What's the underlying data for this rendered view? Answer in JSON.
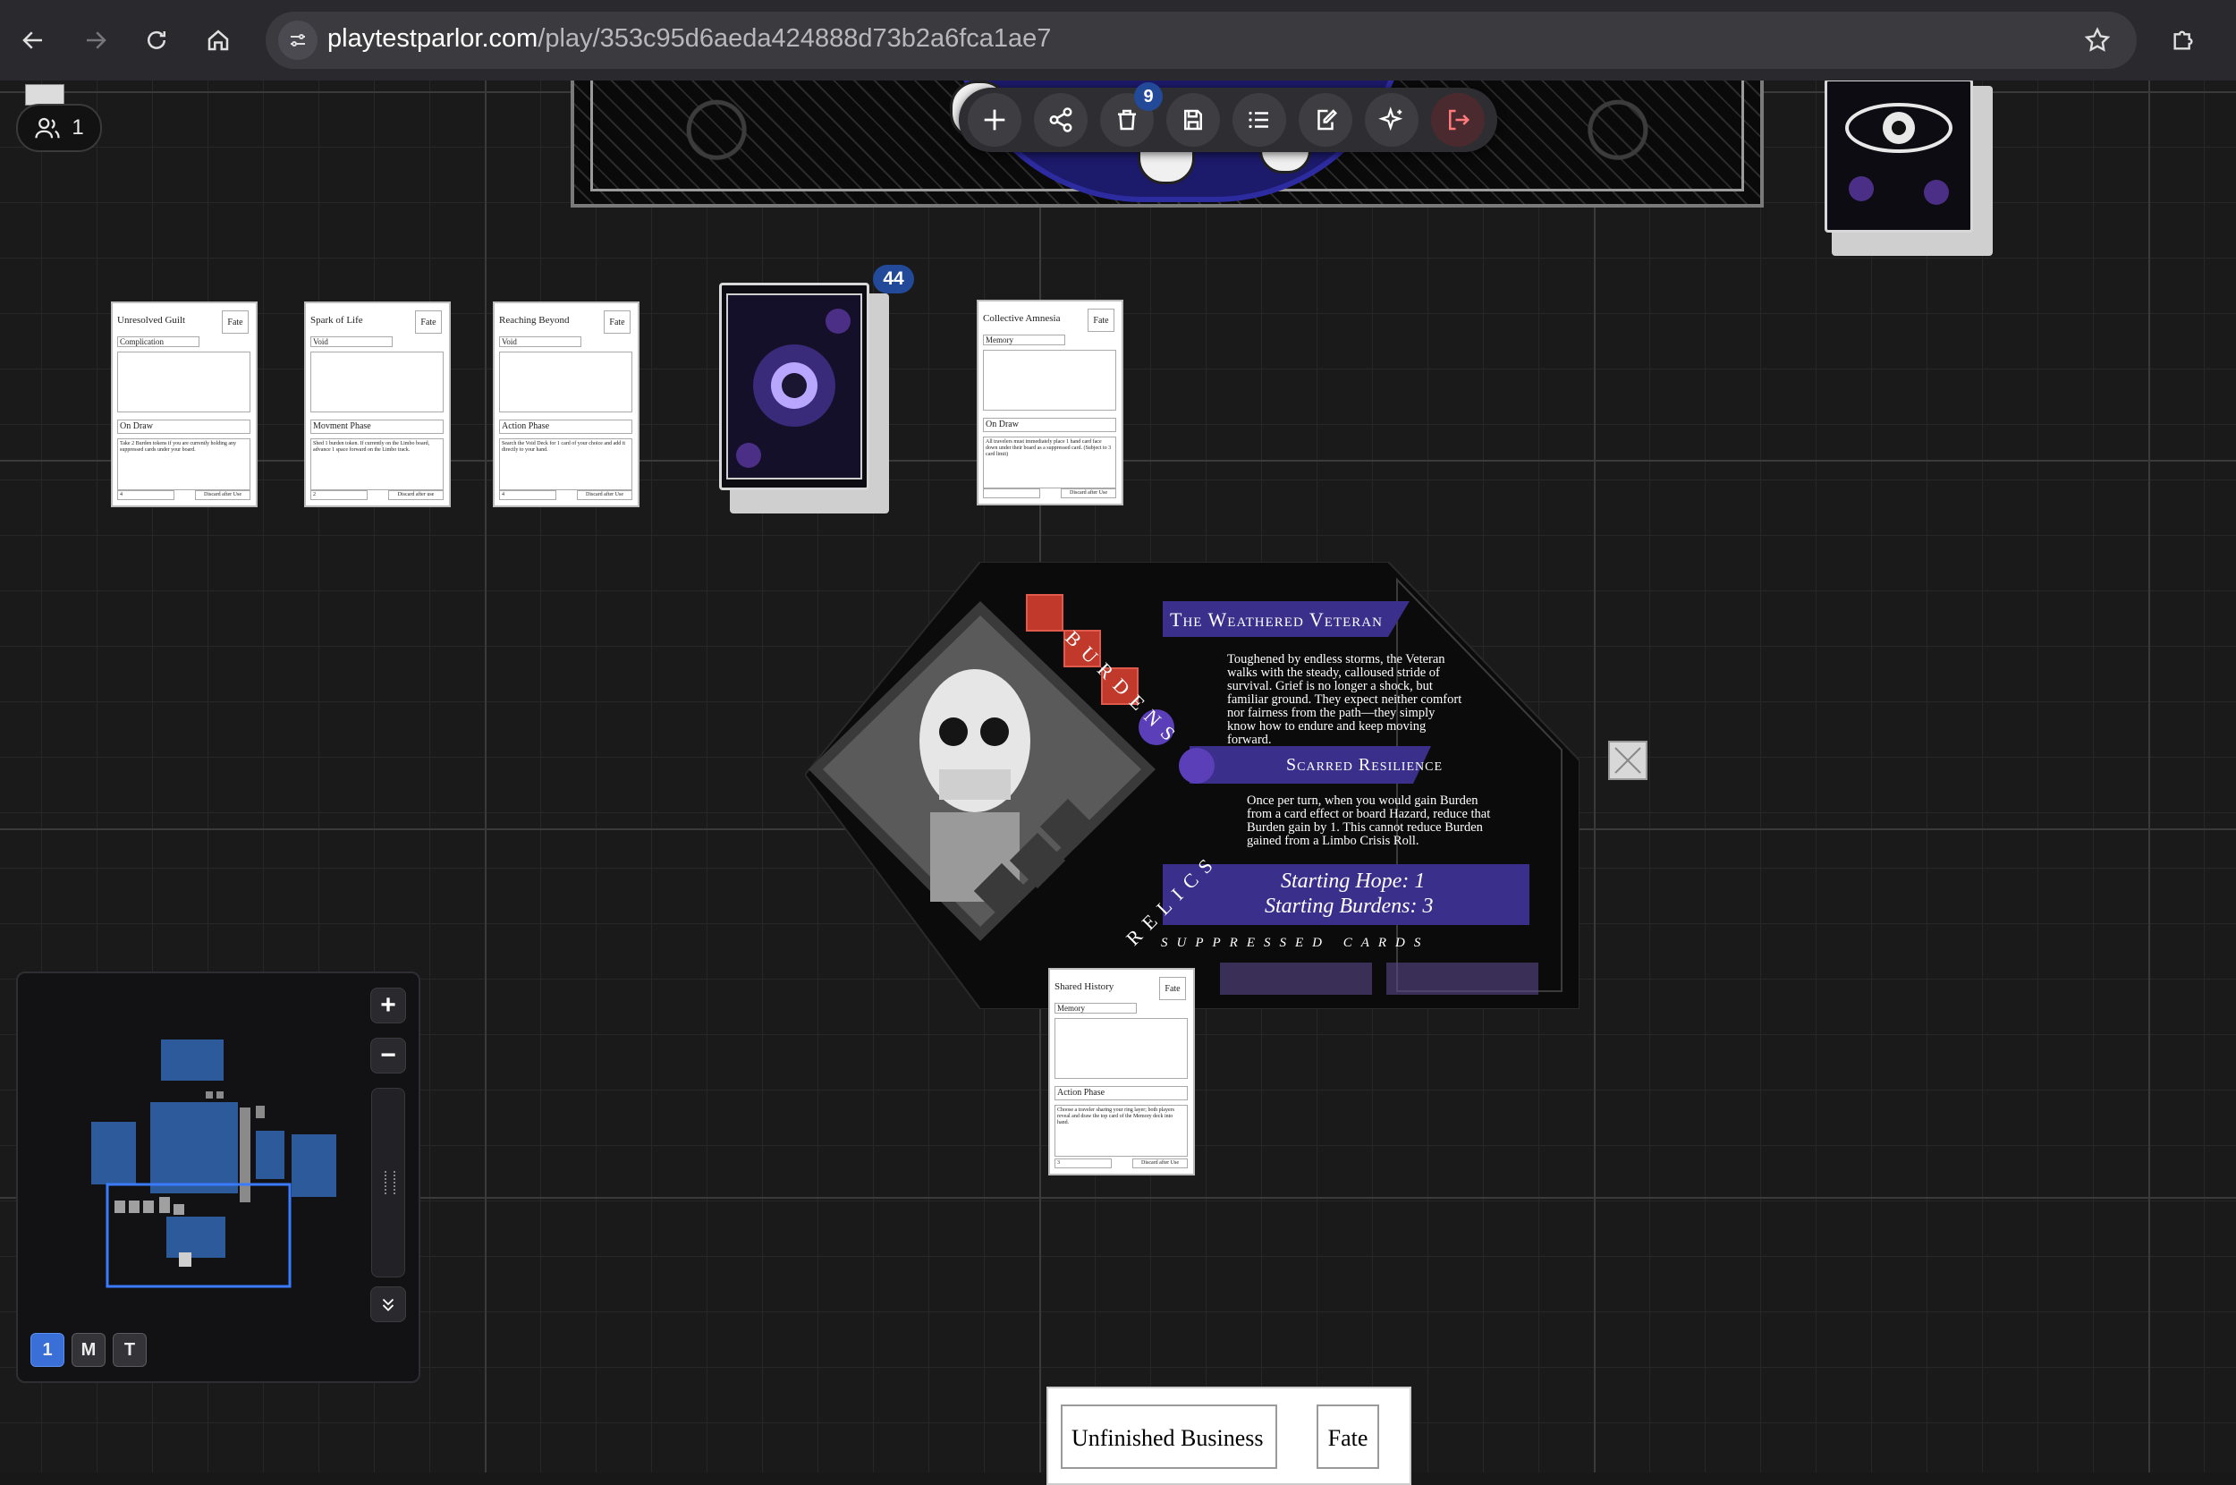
{
  "browser": {
    "url_host": "playtestparlor.com",
    "url_path": "/play/353c95d6aeda424888d73b2a6fca1ae7"
  },
  "toolbar": {
    "buttons": [
      "add-icon",
      "share-icon",
      "trash-icon",
      "save-icon",
      "list-icon",
      "edit-icon",
      "sparkle-icon",
      "exit-icon"
    ],
    "trash_badge": "9"
  },
  "players": {
    "count": "1"
  },
  "cards": [
    {
      "title": "Unresolved Guilt",
      "tag": "Fate",
      "type": "Complication",
      "phase": "On Draw",
      "text": "Take 2 Burden tokens if you are currently holding any suppressed cards under your board.",
      "num": "4",
      "discard": "Discard after Use"
    },
    {
      "title": "Spark of Life",
      "tag": "Fate",
      "type": "Void",
      "phase": "Movment Phase",
      "text": "Shed 1 burden token. If currently on the Limbo board, advance 1 space forward on the Limbo track.",
      "num": "2",
      "discard": "Discard after use"
    },
    {
      "title": "Reaching Beyond",
      "tag": "Fate",
      "type": "Void",
      "phase": "Action Phase",
      "text": "Search the Void Deck for 1 card of your choice and add it directly to your hand.",
      "num": "4",
      "discard": "Discard after Use"
    },
    {
      "title": "Collective Amnesia",
      "tag": "Fate",
      "type": "Memory",
      "phase": "On Draw",
      "text": "All travelers must immediately place 1 hand card face down under their board as a suppressed card. (Subject to 3 card limit)",
      "num": "",
      "discard": "Discard after Use"
    },
    {
      "title": "Shared History",
      "tag": "Fate",
      "type": "Memory",
      "phase": "Action Phase",
      "text": "Choose a traveler sharing your ring layer; both players reveal and draw the top card of the Memory deck into hand.",
      "num": "3",
      "discard": "Discard after Use"
    }
  ],
  "deck": {
    "count": "44"
  },
  "character": {
    "name": "The Weathered Veteran",
    "flavor": "Toughened by endless storms, the Veteran walks with the steady, calloused stride of survival. Grief is no longer a shock, but familiar ground. They expect neither comfort nor fairness from the path—they simply know how to endure and keep moving forward.",
    "ability_name": "Scarred Resilience",
    "ability_text": "Once per turn, when you would gain Burden from a card effect or board Hazard, reduce that Burden gain by 1. This cannot reduce Burden gained from a Limbo Crisis Roll.",
    "hope": "Starting Hope: 1",
    "burdens": "Starting Burdens: 3",
    "label_burdens": "BURDENS",
    "label_relics": "RELICS",
    "label_suppressed": "SUPPRESSED CARDS",
    "burden_tokens": 3,
    "colors": {
      "banner": "#3a2f8a",
      "token": "#c0392b",
      "orb": "#5b3fb8"
    }
  },
  "bottom_card": {
    "title": "Unfinished Business",
    "tag": "Fate"
  },
  "minimap": {
    "zoom_in": "+",
    "zoom_out": "−",
    "layers": [
      "1",
      "M",
      "T"
    ],
    "active_layer": "1"
  }
}
